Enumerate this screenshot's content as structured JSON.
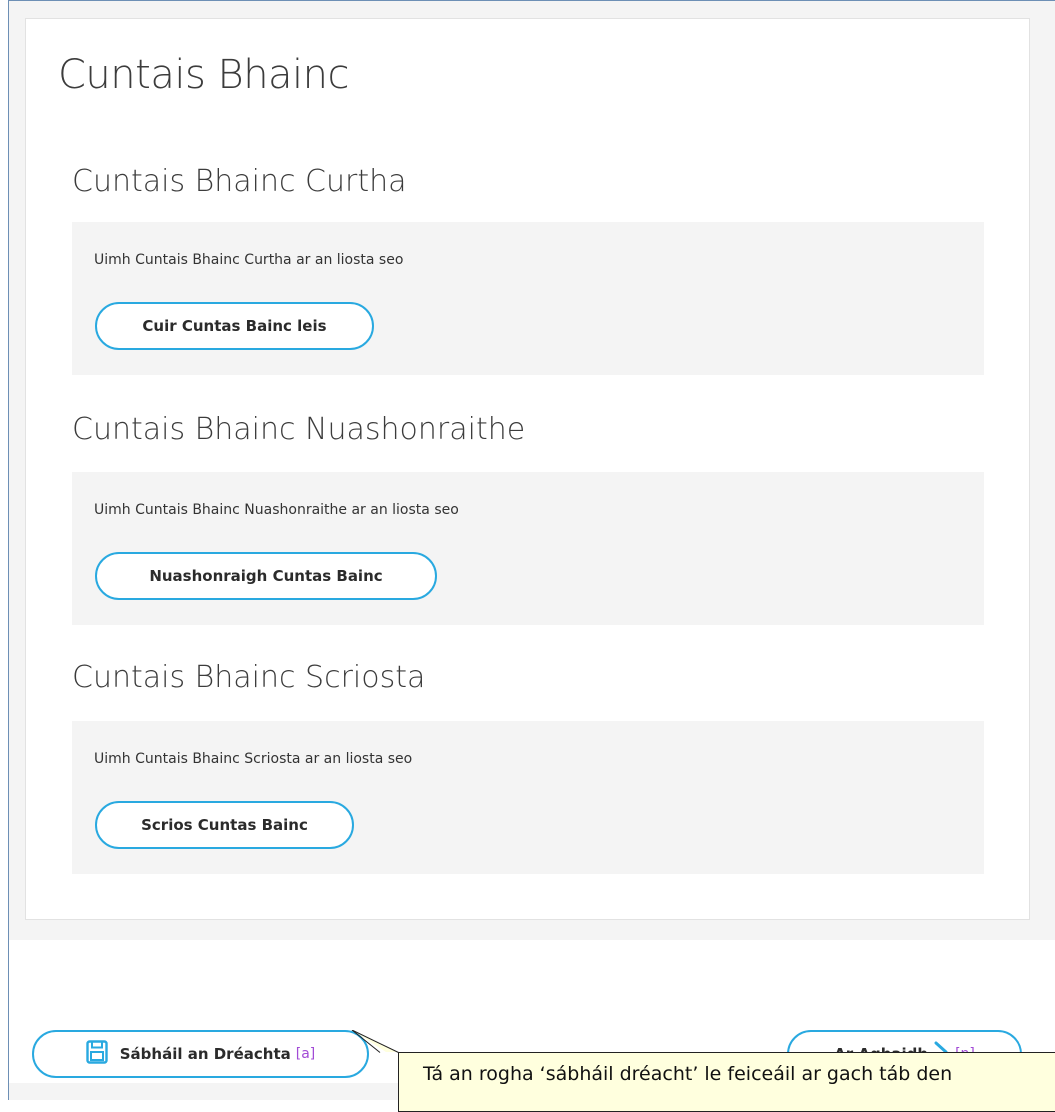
{
  "page": {
    "title": "Cuntais Bhainc"
  },
  "sections": [
    {
      "title": "Cuntais Bhainc Curtha",
      "empty_text": "Uimh Cuntais Bhainc Curtha ar an liosta seo",
      "button_label": "Cuir Cuntas Bainc leis"
    },
    {
      "title": "Cuntais Bhainc Nuashonraithe",
      "empty_text": "Uimh Cuntais Bhainc Nuashonraithe ar an liosta seo",
      "button_label": "Nuashonraigh Cuntas Bainc"
    },
    {
      "title": "Cuntais Bhainc Scriosta",
      "empty_text": "Uimh Cuntais Bhainc Scriosta ar an liosta seo",
      "button_label": "Scrios Cuntas Bainc"
    }
  ],
  "footer": {
    "save": {
      "label": "Sábháil an Dréachta",
      "shortcut": "[a]",
      "icon": "save-icon"
    },
    "next": {
      "label": "Ar Aghaidh",
      "shortcut": "[n]",
      "icon": "chevron-right-icon"
    }
  },
  "callout": {
    "text": "Tá an rogha ‘sábháil dréacht’ le feiceáil ar gach táb den"
  },
  "colors": {
    "accent": "#29a9e0",
    "shortcut": "#a24bd6",
    "panel_bg": "#f4f4f4",
    "callout_bg": "#ffffde"
  }
}
